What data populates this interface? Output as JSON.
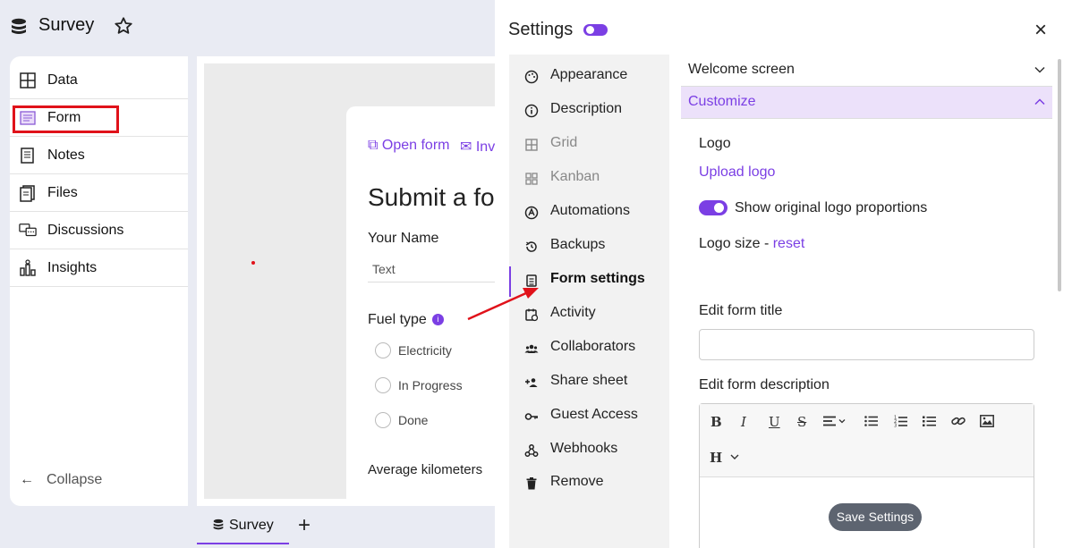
{
  "app": {
    "title": "Survey"
  },
  "sidebar": {
    "items": [
      {
        "label": "Data"
      },
      {
        "label": "Form"
      },
      {
        "label": "Notes"
      },
      {
        "label": "Files"
      },
      {
        "label": "Discussions"
      },
      {
        "label": "Insights"
      }
    ],
    "collapse_label": "Collapse"
  },
  "form_preview": {
    "open_form_link": "Open form",
    "invite_link": "Inv",
    "title": "Submit a fo",
    "q1_label": "Your Name",
    "q1_placeholder": "Text",
    "q2_label": "Fuel type",
    "options": [
      "Electricity",
      "In Progress",
      "Done"
    ],
    "q3_label": "Average kilometers"
  },
  "bottom_tabs": {
    "tab_label": "Survey",
    "add_label": "+"
  },
  "settings": {
    "title": "Settings",
    "close_label": "×",
    "menu": [
      {
        "label": "Appearance"
      },
      {
        "label": "Description"
      },
      {
        "label": "Grid"
      },
      {
        "label": "Kanban"
      },
      {
        "label": "Automations"
      },
      {
        "label": "Backups"
      },
      {
        "label": "Form settings"
      },
      {
        "label": "Activity"
      },
      {
        "label": "Collaborators"
      },
      {
        "label": "Share sheet"
      },
      {
        "label": "Guest Access"
      },
      {
        "label": "Webhooks"
      },
      {
        "label": "Remove"
      }
    ],
    "welcome_screen": "Welcome screen",
    "customize": "Customize",
    "logo_label": "Logo",
    "upload_logo": "Upload logo",
    "show_proportions": "Show original logo proportions",
    "logo_size_label": "Logo size - ",
    "reset_link": "reset",
    "edit_title_label": "Edit form title",
    "edit_title_value": "",
    "edit_desc_label": "Edit form description",
    "toolbar": {
      "bold": "B",
      "italic": "I",
      "underline": "U",
      "strike": "S",
      "heading": "H"
    },
    "save_button": "Save Settings"
  },
  "colors": {
    "accent": "#7b3fe4",
    "highlight_red": "#e0121a"
  }
}
